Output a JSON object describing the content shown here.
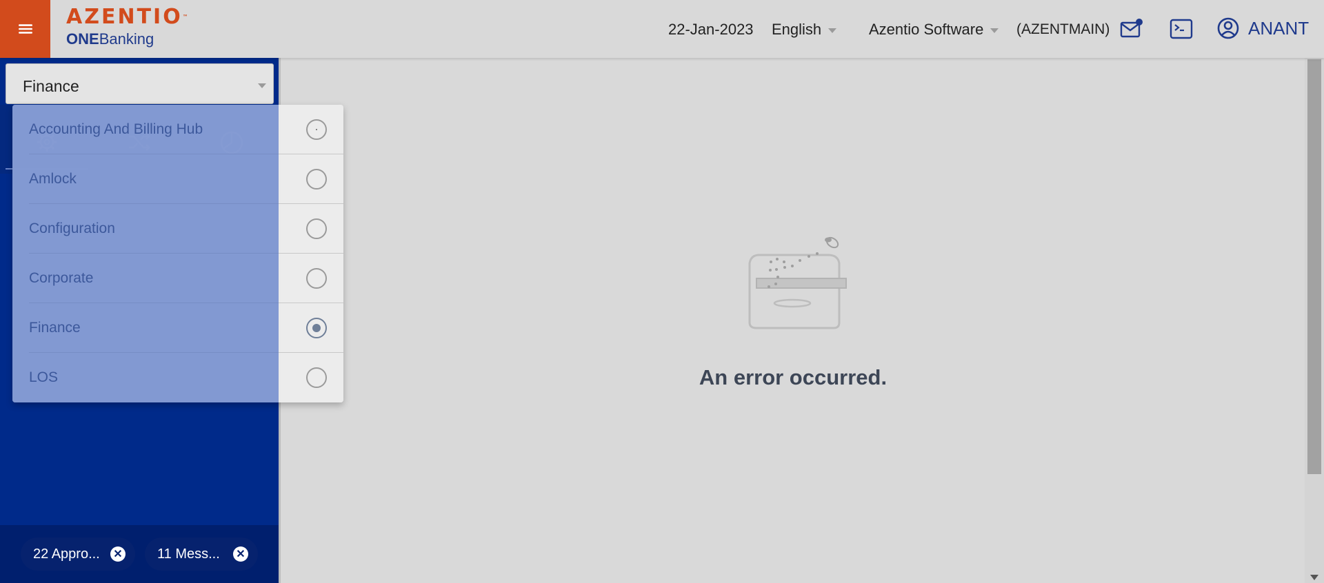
{
  "header": {
    "menu_icon": "hamburger-icon",
    "logo_main": "AZENTIO",
    "logo_tm": "™",
    "logo_sub_bold": "ONE",
    "logo_sub": "Banking",
    "date": "22-Jan-2023",
    "language": "English",
    "company": "Azentio Software",
    "branch": "(AZENTMAIN)",
    "user": "ANANT",
    "icons": [
      "mail-notification-icon",
      "terminal-icon",
      "user-circle-icon"
    ],
    "brand_color": "#d24b1c",
    "accent_color": "#1f3a8c"
  },
  "sidebar": {
    "module_selected": "Finance",
    "strip_icons": [
      "gear-icon",
      "shuffle-icon",
      "pie-chart-icon"
    ],
    "chips": [
      {
        "label": "22 Appro..."
      },
      {
        "label": "11 Mess..."
      }
    ],
    "bg_color": "#002a8a"
  },
  "dropdown": {
    "options": [
      {
        "label": "Accounting And Billing Hub",
        "selected": false
      },
      {
        "label": "Amlock",
        "selected": false
      },
      {
        "label": "Configuration",
        "selected": false
      },
      {
        "label": "Corporate",
        "selected": false
      },
      {
        "label": "Finance",
        "selected": true
      },
      {
        "label": "LOS",
        "selected": false
      }
    ]
  },
  "main": {
    "error_message": "An error occurred.",
    "illustration": "empty-box-icon"
  }
}
